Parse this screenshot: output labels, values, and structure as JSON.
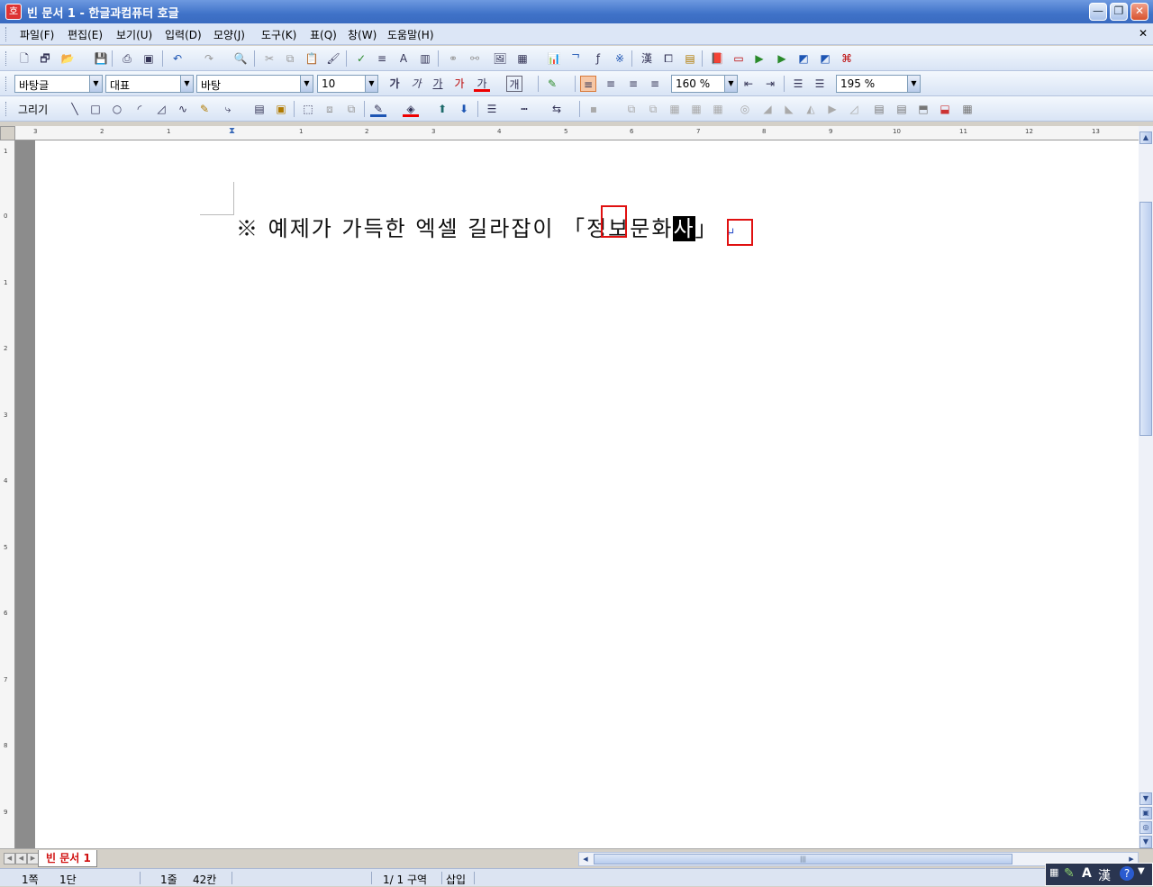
{
  "window": {
    "title": "빈 문서 1 - 한글과컴퓨터 호글",
    "app_icon": "호",
    "minimize": "—",
    "restore": "❐",
    "close": "✕"
  },
  "menu": {
    "items": [
      "파일(F)",
      "편집(E)",
      "보기(U)",
      "입력(D)",
      "모양(J)",
      "도구(K)",
      "표(Q)",
      "창(W)",
      "도움말(H)"
    ],
    "mdi_close": "✕"
  },
  "format_bar": {
    "style": "바탕글",
    "language": "대표",
    "font": "바탕",
    "size": "10",
    "bold": "가",
    "italic": "가",
    "underline": "가",
    "strike": "가",
    "font_color": "가",
    "char_shape": "개",
    "line_spacing": "160 %",
    "zoom": "195 %"
  },
  "draw_bar": {
    "label": "그리기"
  },
  "document": {
    "line_text_plain": "※ 예제가 가득한 엑셀 길라잡이 「정보문화",
    "selected_char": "사",
    "closing_bracket": "」",
    "para_mark": "↵"
  },
  "ruler": {
    "h_ticks": [
      "3",
      "2",
      "1",
      "1",
      "2",
      "3",
      "4",
      "5",
      "6",
      "7",
      "8",
      "9",
      "10",
      "11",
      "12",
      "13"
    ],
    "v_ticks": [
      "1",
      "0",
      "1",
      "2",
      "3",
      "4",
      "5",
      "6",
      "7",
      "8",
      "9"
    ]
  },
  "tabs": {
    "active": "빈 문서 1"
  },
  "status": {
    "page": "1쪽",
    "column": "1단",
    "line": "1줄",
    "char": "42칸",
    "section": "1/  1 구역",
    "mode": "삽입"
  },
  "ime": {
    "mode": "A",
    "hanja": "漢",
    "help": "?"
  },
  "colors": {
    "title_bar": "#3f72c8",
    "highlight_box": "#e01010",
    "tab_text": "#d01010"
  }
}
